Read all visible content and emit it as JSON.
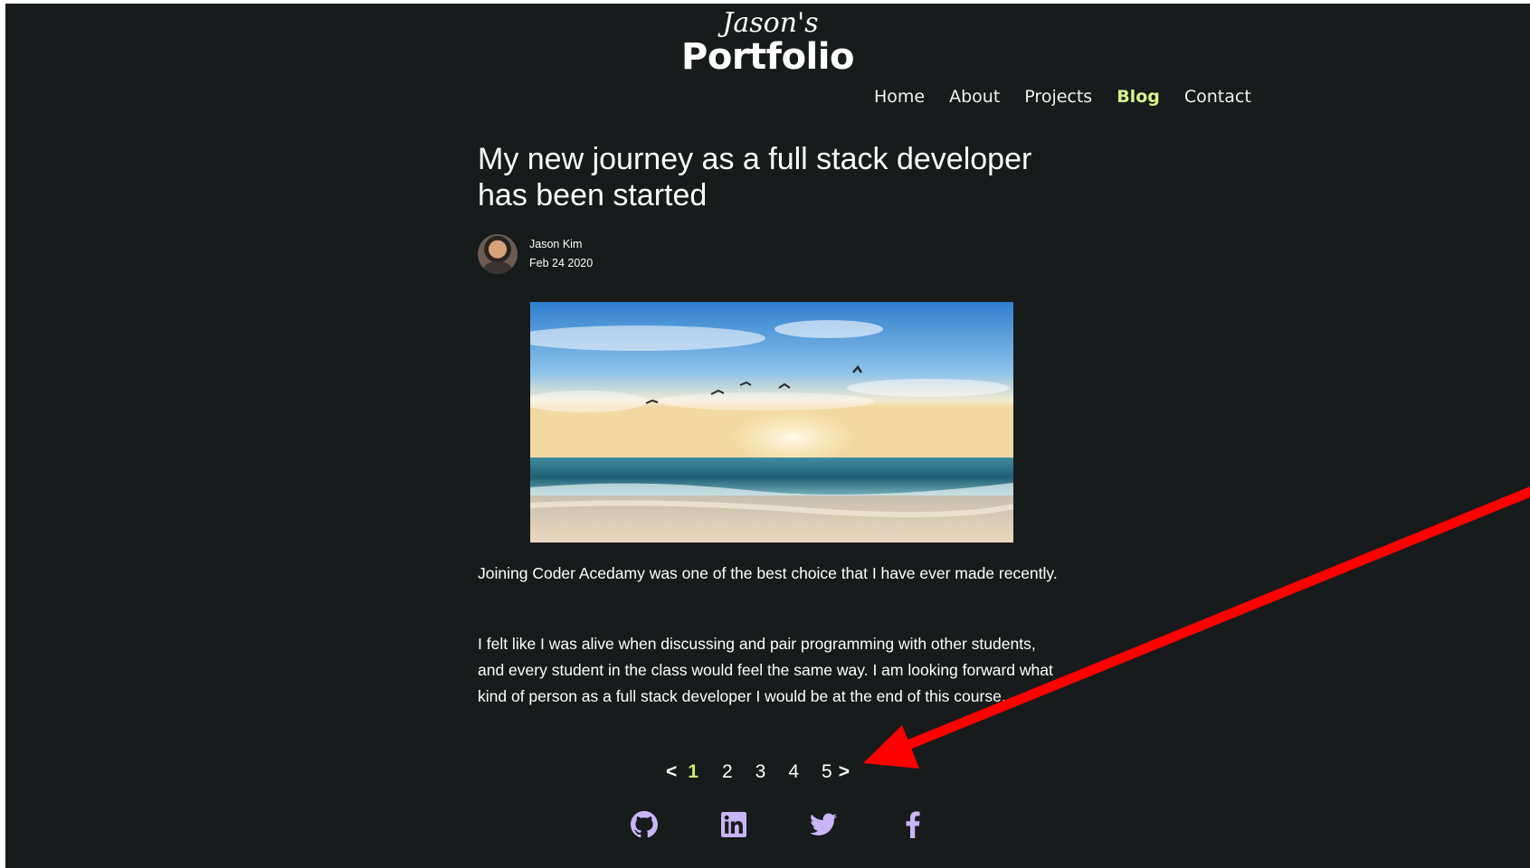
{
  "logo": {
    "script": "Jason's",
    "main": "Portfolio"
  },
  "nav": {
    "items": [
      {
        "label": "Home",
        "active": false
      },
      {
        "label": "About",
        "active": false
      },
      {
        "label": "Projects",
        "active": false
      },
      {
        "label": "Blog",
        "active": true
      },
      {
        "label": "Contact",
        "active": false
      }
    ]
  },
  "post": {
    "title": "My new journey as a full stack developer has been started",
    "author": "Jason Kim",
    "date": "Feb 24 2020",
    "paragraphs": [
      "Joining Coder Acedamy was one of the best choice that I have ever made recently.",
      "I felt like I was alive when discussing and pair programming with other students, and every student in the class would feel the same way. I am looking forward what kind of person as a full stack developer I would be at the end of this course."
    ]
  },
  "pagination": {
    "prev": "<",
    "pages": [
      "1",
      "2",
      "3",
      "4",
      "5"
    ],
    "current": "1",
    "next": ">"
  },
  "social": {
    "icons": [
      "github-icon",
      "linkedin-icon",
      "twitter-icon",
      "facebook-icon"
    ]
  },
  "colors": {
    "background": "#171b1b",
    "accent": "#d8f28a",
    "icon": "#c9b5f5",
    "annotation_arrow": "#ff0000"
  }
}
